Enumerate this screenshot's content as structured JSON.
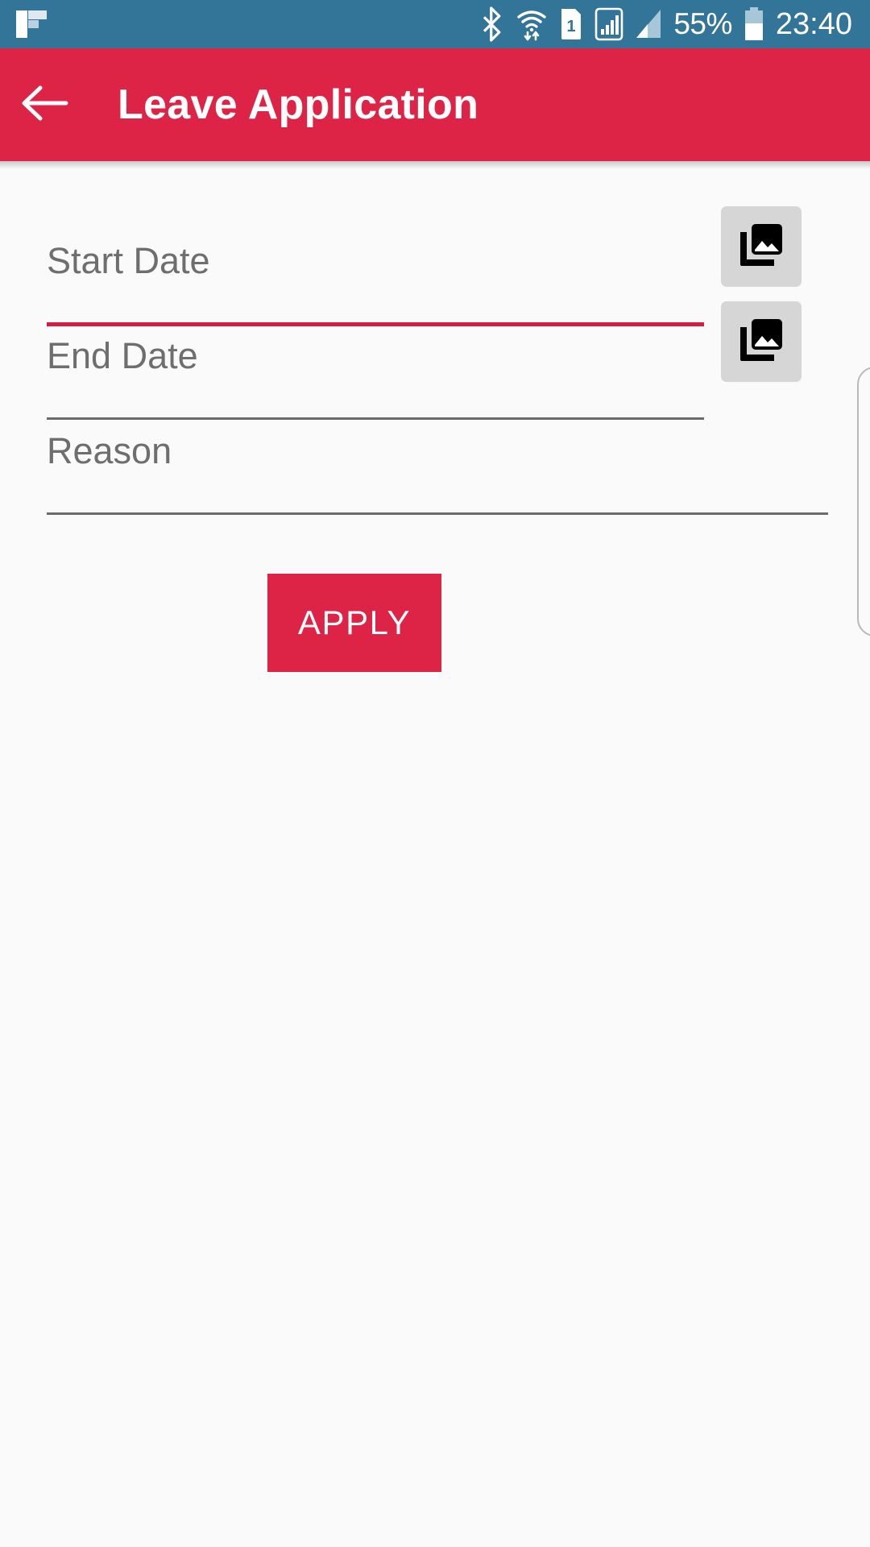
{
  "status_bar": {
    "background": "#337599",
    "notification_icon": "flipboard-logo-icon",
    "icons": [
      "bluetooth-icon",
      "wifi-data-transfer-icon",
      "sim-card-1-icon",
      "signal-boxed-icon",
      "signal-bars-icon"
    ],
    "battery_percent": "55%",
    "battery_icon": "battery-icon",
    "clock": "23:40"
  },
  "app_bar": {
    "background": "#de2446",
    "back_icon": "back-arrow-icon",
    "title": "Leave Application"
  },
  "form": {
    "fields": [
      {
        "label": "Start Date",
        "value": "",
        "placeholder": "Start Date",
        "focused": true,
        "underline_color": "#d81b41",
        "has_picker": true,
        "picker_icon": "photo-library-icon"
      },
      {
        "label": "End Date",
        "value": "",
        "placeholder": "End Date",
        "focused": false,
        "underline_color": "#6b6b6b",
        "has_picker": true,
        "picker_icon": "photo-library-icon"
      },
      {
        "label": "Reason",
        "value": "",
        "placeholder": "Reason",
        "focused": false,
        "underline_color": "#6b6b6b",
        "has_picker": false,
        "picker_icon": ""
      }
    ],
    "submit_label": "APPLY",
    "submit_color": "#de2446"
  },
  "side_panel": {
    "name": "offscreen-card-edge"
  }
}
